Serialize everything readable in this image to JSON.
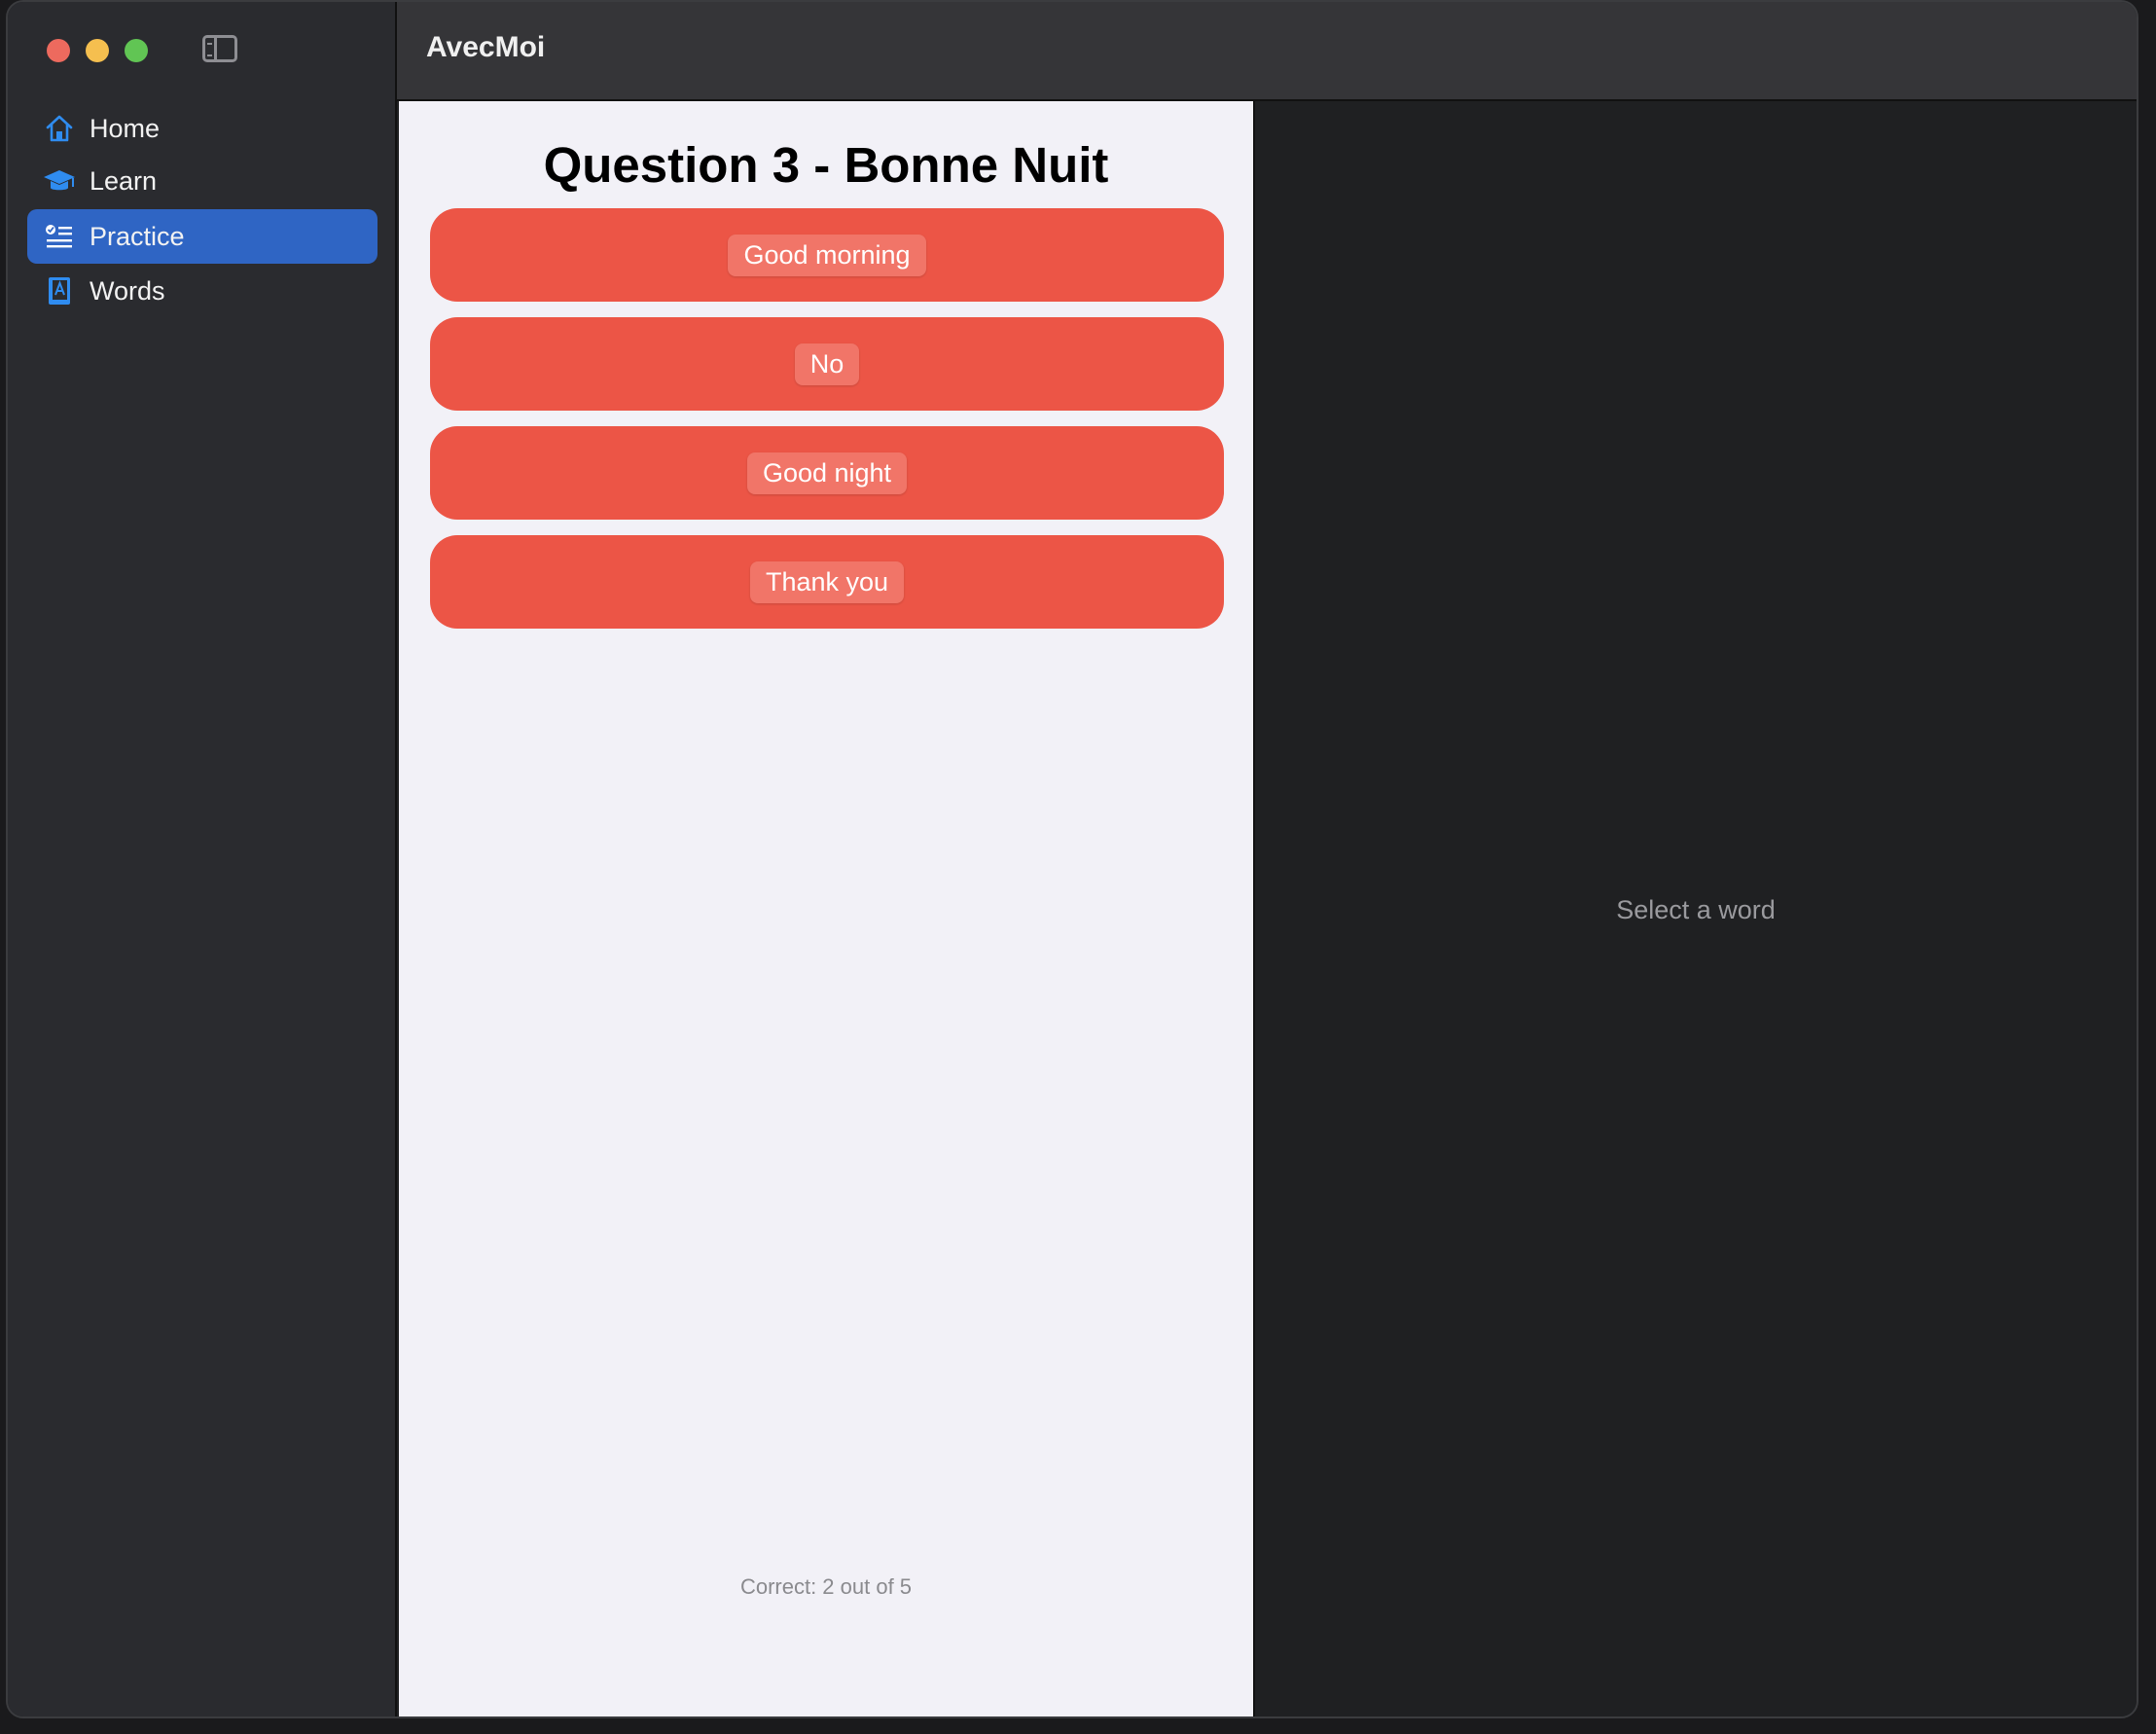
{
  "app": {
    "title": "AvecMoi"
  },
  "sidebar": {
    "items": [
      {
        "label": "Home",
        "icon": "house-icon",
        "active": false
      },
      {
        "label": "Learn",
        "icon": "graduation-cap-icon",
        "active": false
      },
      {
        "label": "Practice",
        "icon": "checklist-icon",
        "active": true
      },
      {
        "label": "Words",
        "icon": "book-icon",
        "active": false
      }
    ]
  },
  "practice": {
    "question_title": "Question 3 - Bonne Nuit",
    "answers": [
      "Good morning",
      "No",
      "Good night",
      "Thank you"
    ],
    "score_text": "Correct: 2 out of 5"
  },
  "detail": {
    "placeholder": "Select a word"
  },
  "colors": {
    "accent": "#2f65c4",
    "icon_blue": "#2f8cf0",
    "answer_red": "#ec5546"
  }
}
